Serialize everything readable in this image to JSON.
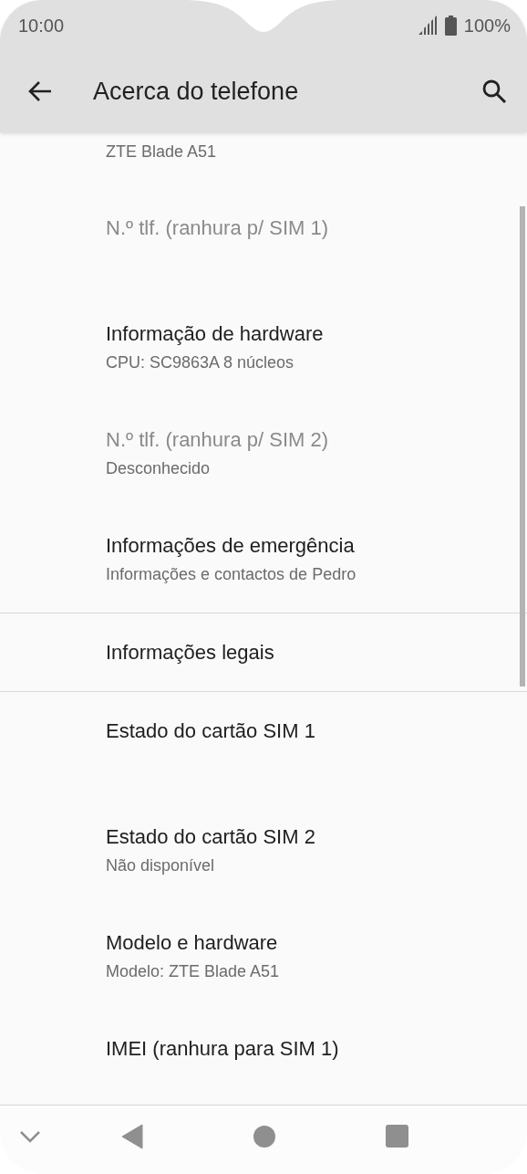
{
  "status_bar": {
    "time": "10:00",
    "battery": "100%"
  },
  "app_bar": {
    "title": "Acerca do telefone"
  },
  "groups": [
    {
      "items": [
        {
          "kind": "partial",
          "summary": "ZTE Blade A51"
        },
        {
          "kind": "setting",
          "title": "N.º tlf. (ranhura p/ SIM 1)",
          "disabled": true
        },
        {
          "kind": "setting",
          "title": "Informação de hardware",
          "summary": "CPU: SC9863A 8 núcleos",
          "disabled": false
        },
        {
          "kind": "setting",
          "title": "N.º tlf. (ranhura p/ SIM 2)",
          "summary": "Desconhecido",
          "disabled": true
        },
        {
          "kind": "setting",
          "title": "Informações de emergência",
          "summary": "Informações e contactos de Pedro",
          "disabled": false
        }
      ]
    },
    {
      "items": [
        {
          "kind": "single",
          "title": "Informações legais",
          "disabled": false
        }
      ]
    },
    {
      "items": [
        {
          "kind": "setting",
          "title": "Estado do cartão SIM 1",
          "disabled": false
        },
        {
          "kind": "setting",
          "title": "Estado do cartão SIM 2",
          "summary": "Não disponível",
          "disabled": false
        },
        {
          "kind": "setting",
          "title": "Modelo e hardware",
          "summary": "Modelo: ZTE Blade A51",
          "disabled": false
        },
        {
          "kind": "setting",
          "title": "IMEI (ranhura para SIM 1)",
          "disabled": false
        }
      ]
    }
  ]
}
